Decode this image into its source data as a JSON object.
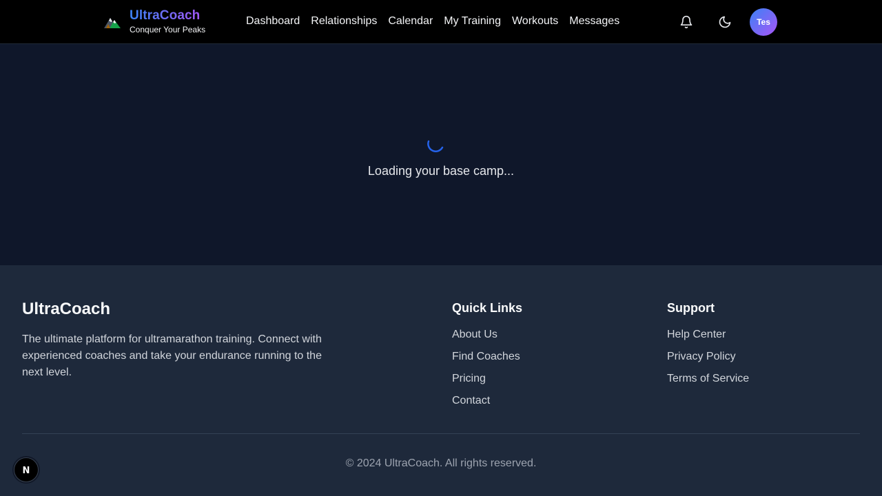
{
  "header": {
    "brand_title": "UltraCoach",
    "brand_tagline": "Conquer Your Peaks",
    "nav": [
      "Dashboard",
      "Relationships",
      "Calendar",
      "My Training",
      "Workouts",
      "Messages"
    ],
    "notifications_icon": "bell-icon",
    "theme_icon": "moon-icon",
    "avatar_initials": "Tes"
  },
  "main": {
    "loading_text": "Loading your base camp..."
  },
  "footer": {
    "brand": "UltraCoach",
    "description": "The ultimate platform for ultramarathon training. Connect with experienced coaches and take your endurance running to the next level.",
    "quick_links": {
      "title": "Quick Links",
      "links": [
        "About Us",
        "Find Coaches",
        "Pricing",
        "Contact"
      ]
    },
    "support": {
      "title": "Support",
      "links": [
        "Help Center",
        "Privacy Policy",
        "Terms of Service"
      ]
    },
    "copyright": "© 2024 UltraCoach. All rights reserved."
  },
  "dev_badge": {
    "label": "N"
  },
  "colors": {
    "header_bg": "#000000",
    "main_bg": "#0f172a",
    "footer_bg": "#1e293b",
    "accent_blue": "#3b82f6",
    "accent_purple": "#a855f7",
    "spinner": "#2563eb"
  }
}
